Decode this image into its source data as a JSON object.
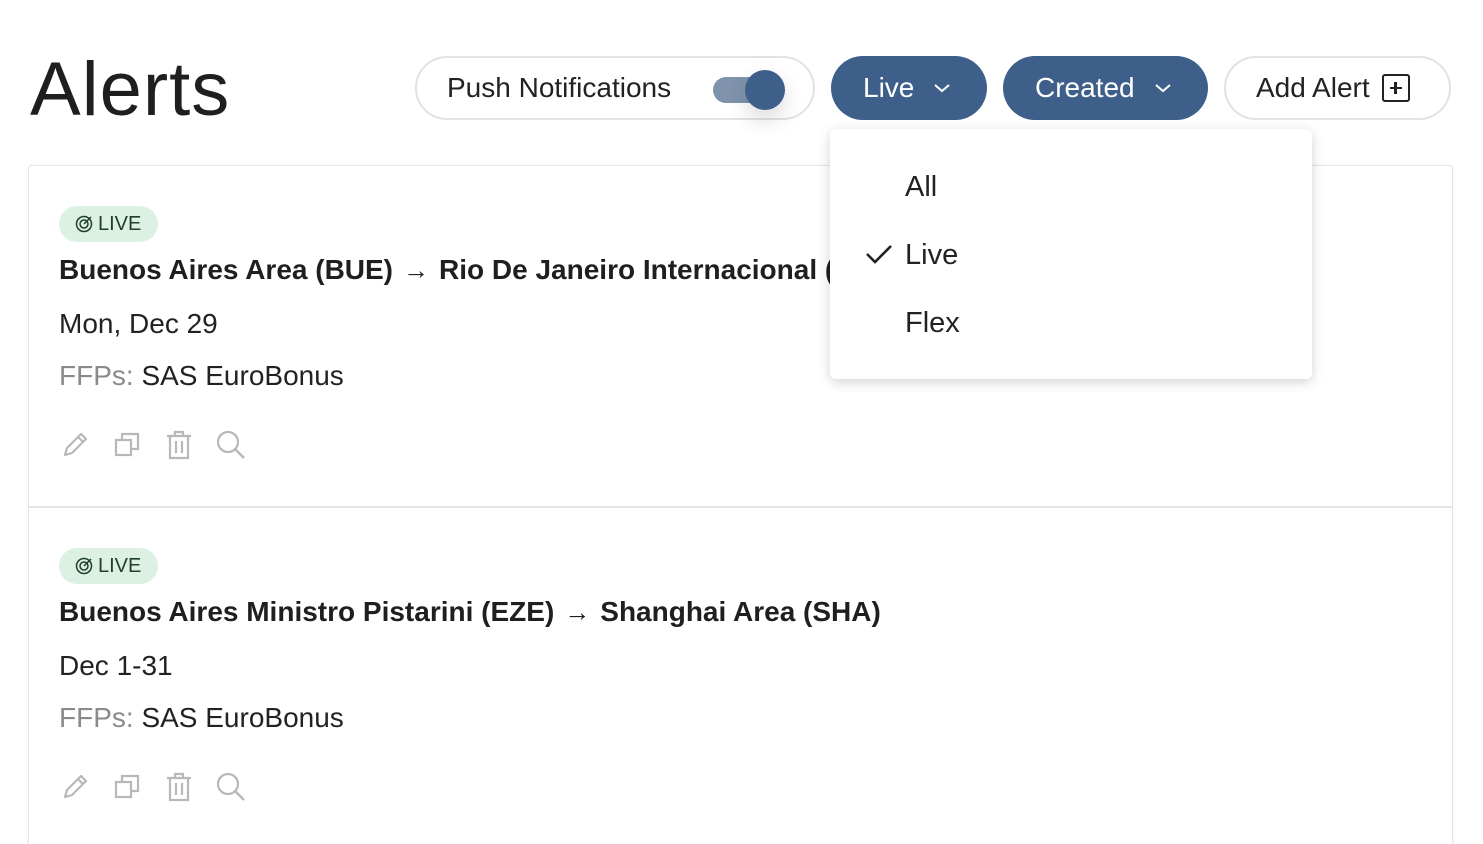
{
  "header": {
    "title": "Alerts",
    "push_label": "Push Notifications",
    "push_enabled": true,
    "filter_label": "Live",
    "sort_label": "Created",
    "add_label": "Add Alert"
  },
  "filter_menu": {
    "options": [
      "All",
      "Live",
      "Flex"
    ],
    "selected": "Live"
  },
  "alerts": [
    {
      "badge": "LIVE",
      "origin": "Buenos Aires Area (BUE)",
      "destination": "Rio De Janeiro Internacional (GIG)",
      "arrow": "→",
      "date": "Mon, Dec 29",
      "ffp_label": "FFPs:",
      "ffp_value": "SAS EuroBonus"
    },
    {
      "badge": "LIVE",
      "origin": "Buenos Aires Ministro Pistarini (EZE)",
      "destination": "Shanghai Area (SHA)",
      "arrow": "→",
      "date": "Dec 1-31",
      "ffp_label": "FFPs:",
      "ffp_value": "SAS EuroBonus"
    }
  ],
  "colors": {
    "primary": "#3d5f8a",
    "badge_bg": "#dcf1e4",
    "icon_gray": "#b8b8b8"
  },
  "icons": [
    "target-icon",
    "edit-icon",
    "duplicate-icon",
    "delete-icon",
    "search-icon",
    "chevron-down-icon",
    "add-box-icon",
    "check-icon"
  ]
}
